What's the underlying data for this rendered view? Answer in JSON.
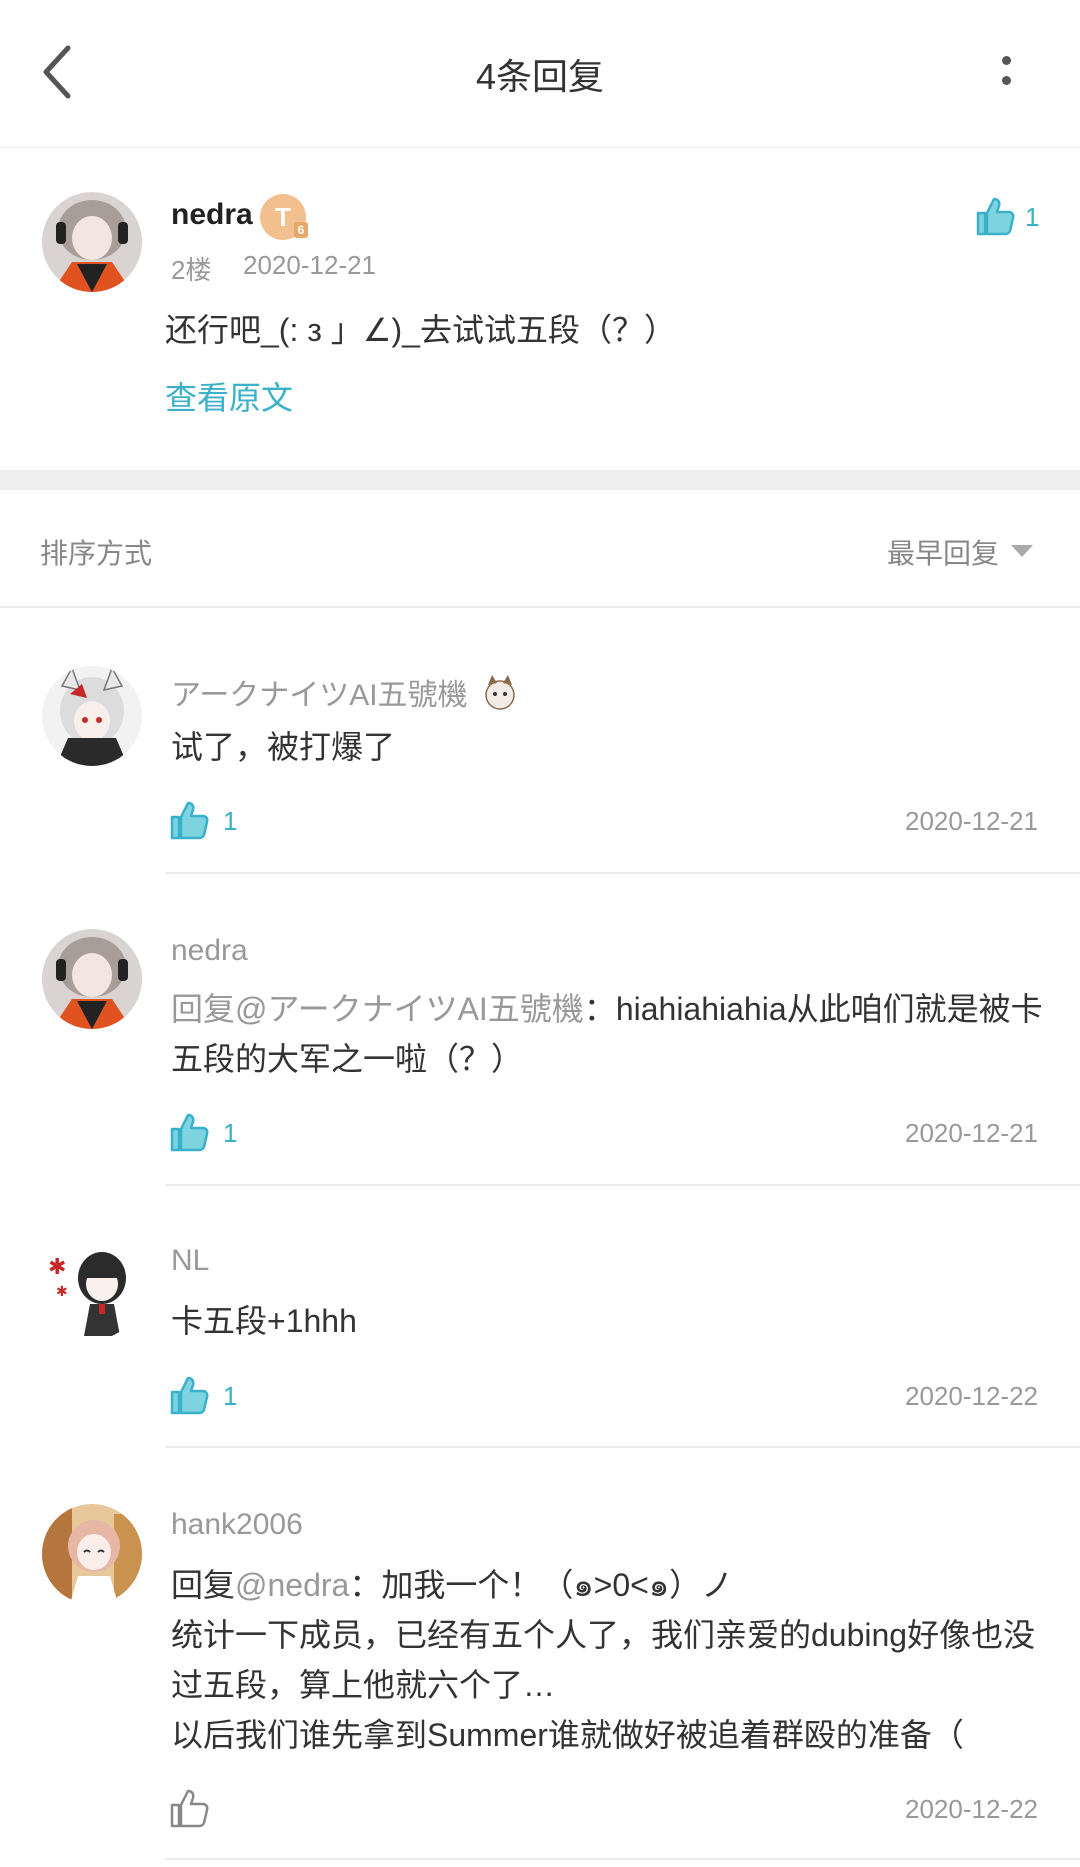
{
  "header": {
    "title": "4条回复",
    "back_icon": "chevron-left-icon",
    "more_icon": "more-vertical-icon"
  },
  "main_comment": {
    "username": "nedra",
    "level": "T",
    "level_sub": "6",
    "floor": "2楼",
    "date": "2020-12-21",
    "text": "还行吧_(: з 」∠)_去试试五段（？）",
    "view_original": "查看原文",
    "likes": "1"
  },
  "sort": {
    "label": "排序方式",
    "value": "最早回复"
  },
  "replies": [
    {
      "username": "アークナイツAI五號機",
      "text": "试了，被打爆了",
      "likes": "1",
      "date": "2020-12-21"
    },
    {
      "username": "nedra",
      "mention": "回复@アークナイツAI五號機",
      "text": "：hiahiahiahia从此咱们就是被卡五段的大军之一啦（？）",
      "likes": "1",
      "date": "2020-12-21"
    },
    {
      "username": "NL",
      "text": "卡五段+1hhh",
      "likes": "1",
      "date": "2020-12-22"
    },
    {
      "username": "hank2006",
      "mention_prefix": "回复",
      "mention": "@nedra",
      "line1": "：加我一个！（๑>0<๑）ノ",
      "line2": "统计一下成员，已经有五个人了，我们亲爱的dubing好像也没过五段，算上他就六个了…",
      "line3": "以后我们谁先拿到Summer谁就做好被追着群殴的准备（",
      "likes": "",
      "date": "2020-12-22"
    }
  ],
  "colors": {
    "accent": "#3ab1c8",
    "muted": "#999999",
    "text": "#333333"
  }
}
